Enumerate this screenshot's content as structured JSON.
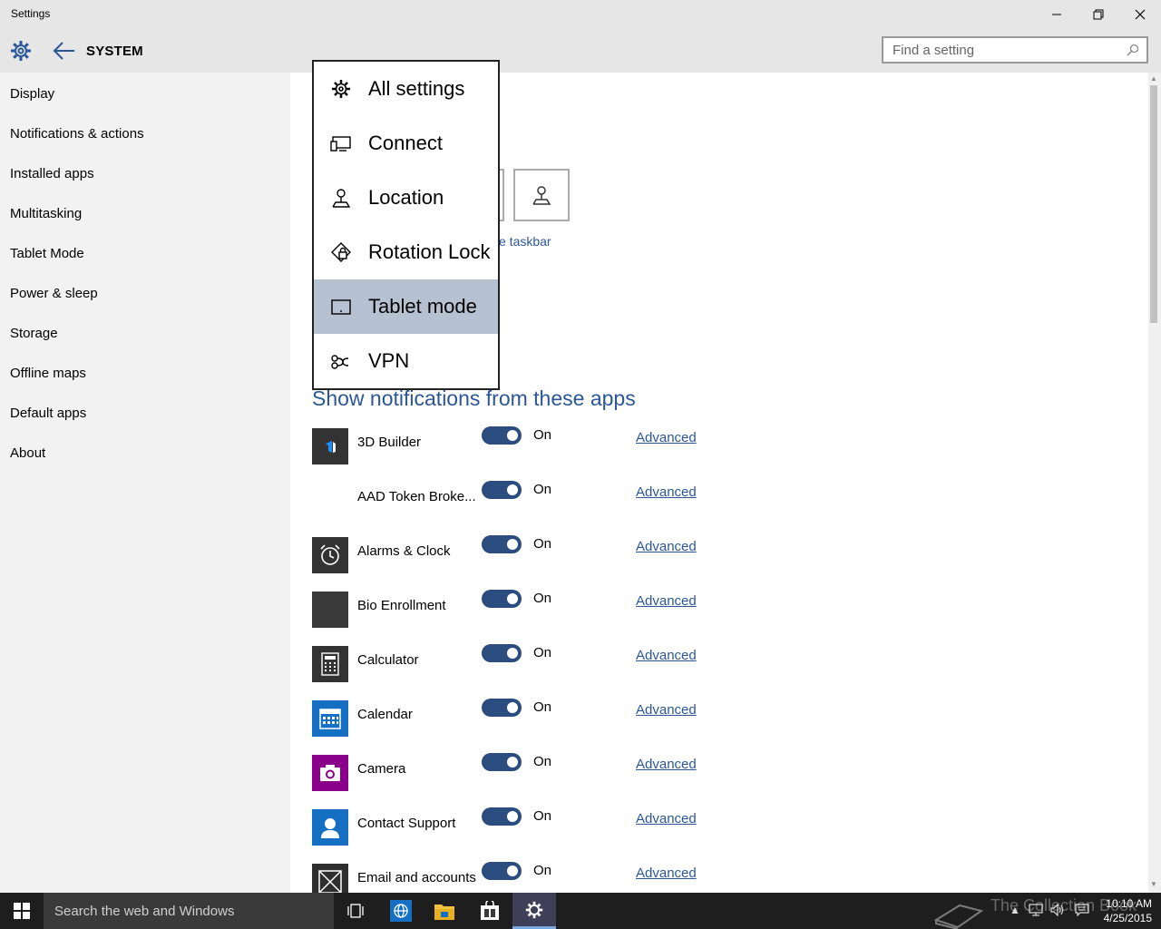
{
  "window": {
    "title": "Settings",
    "controls": [
      "minimize",
      "maximize",
      "close"
    ]
  },
  "header": {
    "section": "SYSTEM",
    "search_placeholder": "Find a setting"
  },
  "sidebar": {
    "items": [
      {
        "label": "Display"
      },
      {
        "label": "Notifications & actions"
      },
      {
        "label": "Installed apps"
      },
      {
        "label": "Multitasking"
      },
      {
        "label": "Tablet Mode"
      },
      {
        "label": "Power & sleep"
      },
      {
        "label": "Storage"
      },
      {
        "label": "Offline maps"
      },
      {
        "label": "Default apps"
      },
      {
        "label": "About"
      }
    ]
  },
  "content": {
    "taskbar_link_partial": "e taskbar",
    "notifications_heading": "Show notifications from these apps",
    "apps": [
      {
        "name": "3D Builder",
        "state": "On",
        "link": "Advanced",
        "icon": "3d-builder-icon",
        "icon_color": "#333333"
      },
      {
        "name": "AAD Token Broke...",
        "state": "On",
        "link": "Advanced",
        "icon": "none",
        "icon_color": "#ffffff"
      },
      {
        "name": "Alarms & Clock",
        "state": "On",
        "link": "Advanced",
        "icon": "alarm-clock-icon",
        "icon_color": "#333333"
      },
      {
        "name": "Bio Enrollment",
        "state": "On",
        "link": "Advanced",
        "icon": "bio-enrollment-icon",
        "icon_color": "#3a3a3a"
      },
      {
        "name": "Calculator",
        "state": "On",
        "link": "Advanced",
        "icon": "calculator-icon",
        "icon_color": "#333333"
      },
      {
        "name": "Calendar",
        "state": "On",
        "link": "Advanced",
        "icon": "calendar-icon",
        "icon_color": "#1570c4"
      },
      {
        "name": "Camera",
        "state": "On",
        "link": "Advanced",
        "icon": "camera-icon",
        "icon_color": "#8b008b"
      },
      {
        "name": "Contact Support",
        "state": "On",
        "link": "Advanced",
        "icon": "contact-support-icon",
        "icon_color": "#1570c4"
      },
      {
        "name": "Email and accounts",
        "state": "On",
        "link": "Advanced",
        "icon": "email-icon",
        "icon_color": "#2e2e2e"
      }
    ]
  },
  "dropdown": {
    "items": [
      {
        "label": "All settings",
        "icon": "gear-icon",
        "selected": false
      },
      {
        "label": "Connect",
        "icon": "connect-icon",
        "selected": false
      },
      {
        "label": "Location",
        "icon": "location-icon",
        "selected": false
      },
      {
        "label": "Rotation Lock",
        "icon": "rotation-lock-icon",
        "selected": false
      },
      {
        "label": "Tablet mode",
        "icon": "tablet-mode-icon",
        "selected": true
      },
      {
        "label": "VPN",
        "icon": "vpn-icon",
        "selected": false
      }
    ]
  },
  "taskbar": {
    "search_text": "Search the web and Windows",
    "watermark": "The Collection Book",
    "time": "10:10 AM",
    "date": "4/25/2015"
  },
  "colors": {
    "accent": "#2b5797",
    "toggle_on": "#2b4c7e",
    "selected_item": "#b6c2d2",
    "chrome": "#e6e6e6",
    "sidebar": "#f2f2f2",
    "taskbar": "#1e1e1e"
  }
}
